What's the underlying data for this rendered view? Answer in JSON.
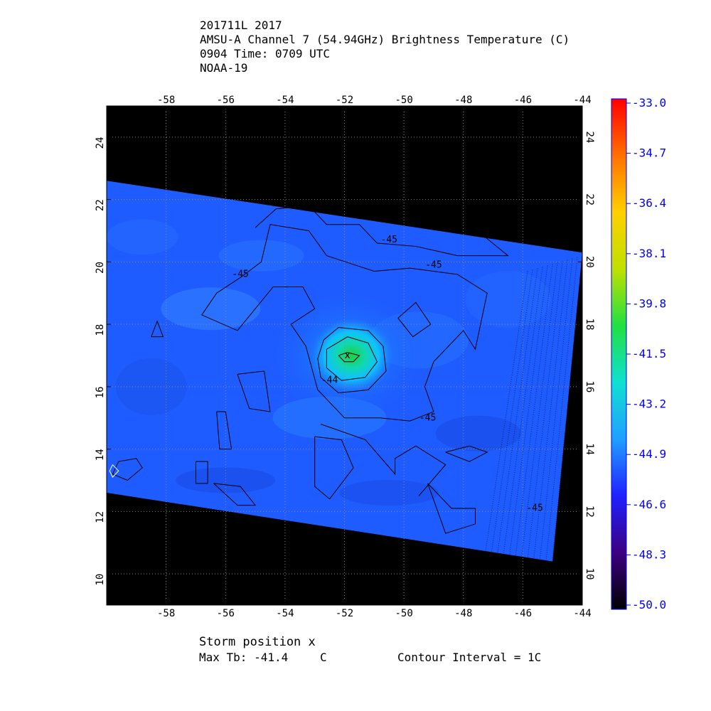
{
  "header": {
    "line1": "201711L 2017",
    "line2": "AMSU-A Channel 7 (54.94GHz) Brightness Temperature (C)",
    "line3": "0904 Time: 0709 UTC",
    "line4": "NOAA-19"
  },
  "map": {
    "lon_range": [
      -60,
      -44
    ],
    "lat_range": [
      9,
      25
    ],
    "lon_ticks": [
      -58,
      -56,
      -54,
      -52,
      -50,
      -48,
      -46,
      -44
    ],
    "lon_tick_labels": [
      "-58",
      "-56",
      "-54",
      "-52",
      "-50",
      "-48",
      "-46",
      "-44"
    ],
    "lat_ticks": [
      10,
      12,
      14,
      16,
      18,
      20,
      22,
      24
    ],
    "lat_tick_labels": [
      "10",
      "12",
      "14",
      "16",
      "18",
      "20",
      "22",
      "24"
    ],
    "swath_corners": [
      [
        -60,
        22.6
      ],
      [
        -44,
        20.3
      ],
      [
        -45,
        10.4
      ],
      [
        -60,
        12.6
      ]
    ],
    "storm_center": [
      -51.9,
      17.0
    ],
    "storm_marker": "x",
    "contour_labels": [
      {
        "text": "-45",
        "lon": -50.5,
        "lat": 20.7
      },
      {
        "text": "-45",
        "lon": -49.0,
        "lat": 19.9
      },
      {
        "text": "-45",
        "lon": -55.5,
        "lat": 19.6
      },
      {
        "text": "-44",
        "lon": -52.5,
        "lat": 16.2
      },
      {
        "text": "-45",
        "lon": -49.2,
        "lat": 15.0
      },
      {
        "text": "-45",
        "lon": -45.6,
        "lat": 12.1
      }
    ],
    "colors": {
      "background": "#000000",
      "field": "#1e5cff",
      "grid": "#8a8a8a"
    }
  },
  "colorbar": {
    "max": -33.0,
    "min": -50.0,
    "tick_labels": [
      "-33.0",
      "-34.7",
      "-36.4",
      "-38.1",
      "-39.8",
      "-41.5",
      "-43.2",
      "-44.9",
      "-46.6",
      "-48.3",
      "-50.0"
    ],
    "label_color": "#0000ff",
    "stops": [
      "#000000",
      "#3c0080",
      "#2020ff",
      "#20a0ff",
      "#10e0d0",
      "#20e040",
      "#c0e000",
      "#ffd000",
      "#ff7000",
      "#ff0000"
    ]
  },
  "footer": {
    "storm_position": "Storm position x",
    "max_tb_label": "Max Tb: -41.4",
    "max_tb_unit": "C",
    "contour_interval": "Contour Interval = 1C"
  }
}
